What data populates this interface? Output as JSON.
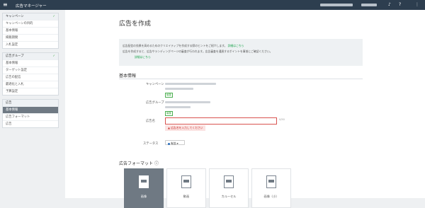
{
  "app": {
    "title": "広告マネージャー",
    "menu_icon": "hamburger-icon"
  },
  "sidebar": {
    "groups": [
      {
        "items": [
          {
            "label": "キャンペーン",
            "head": true,
            "check": true
          },
          {
            "label": "キャンペーンの目的"
          },
          {
            "label": "基本情報"
          },
          {
            "label": "掲載期間"
          },
          {
            "label": "入札設定"
          }
        ]
      },
      {
        "items": [
          {
            "label": "広告グループ",
            "head": true,
            "check": true
          },
          {
            "label": "基本情報"
          },
          {
            "label": "ターゲット設定"
          },
          {
            "label": "広告の配信"
          },
          {
            "label": "最適化と入札"
          },
          {
            "label": "予算設定"
          }
        ]
      },
      {
        "items": [
          {
            "label": "広告",
            "head": true
          },
          {
            "label": "基本情報",
            "active": true
          },
          {
            "label": "広告フォーマット"
          },
          {
            "label": "広告"
          }
        ]
      }
    ]
  },
  "main": {
    "title": "広告を作成",
    "info": {
      "line1": "広告配信の効果を高めるためのクリエイティブを作成する際のヒントをご紹介します。",
      "line1_link": "詳細はこちら",
      "line2": "広告を作成すると、広告やランディングページの審査が行われます。広告審査を通過するポイントを事前にご確認ください。",
      "line3_link": "詳細はこちら"
    },
    "basic_section": "基本情報",
    "fields": {
      "campaign_label": "キャンペーン",
      "campaign_tag": "編集",
      "adgroup_label": "広告グループ",
      "adgroup_tag": "編集",
      "adname_label": "広告名",
      "adname_value": "",
      "adname_counter": "0/50",
      "adname_error": "広告名を入力してください",
      "status_label": "ステータス",
      "status_value": "有効"
    },
    "format_section": "広告フォーマット",
    "formats": [
      {
        "label": "画像",
        "active": true
      },
      {
        "label": "動画"
      },
      {
        "label": "カルーセル"
      },
      {
        "label": "画像（小）"
      }
    ]
  },
  "colors": {
    "topbar": "#2d3e4f",
    "accent_green": "#4caf50",
    "error_red": "#d9534f",
    "active_gray": "#6f7983"
  }
}
